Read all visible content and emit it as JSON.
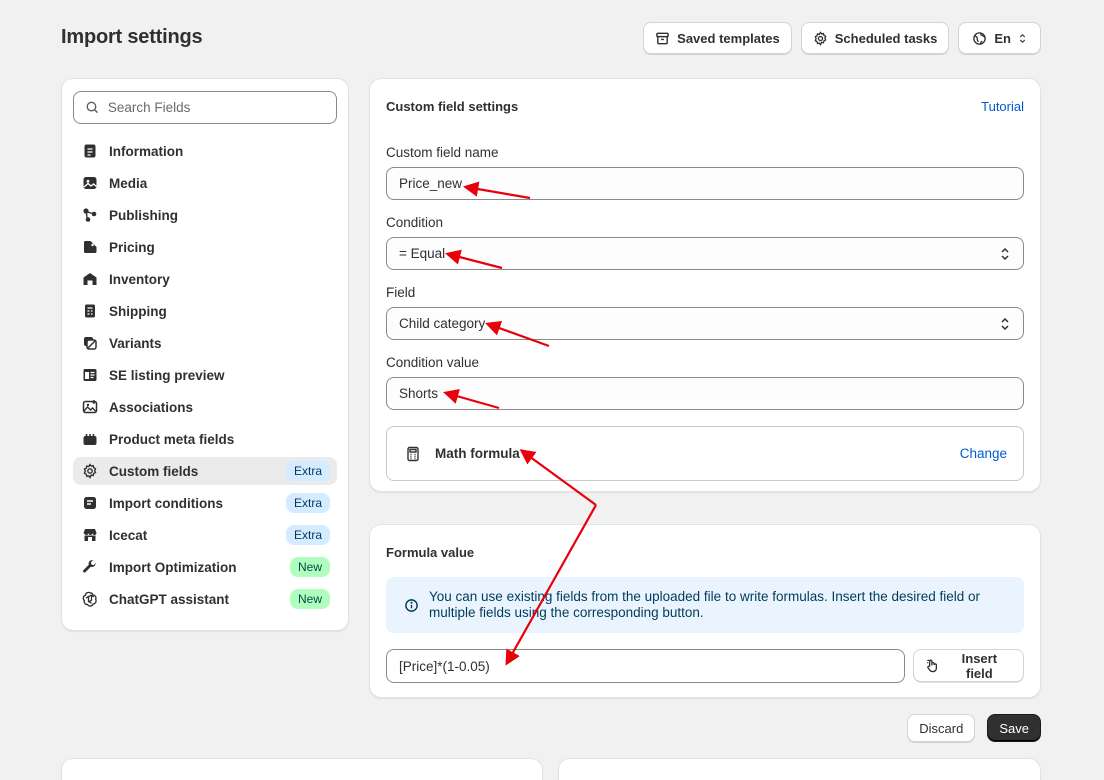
{
  "page": {
    "title": "Import settings"
  },
  "header": {
    "saved_templates": "Saved templates",
    "scheduled_tasks": "Scheduled tasks",
    "language": "En"
  },
  "sidebar": {
    "search_placeholder": "Search Fields",
    "items": [
      {
        "label": "Information",
        "icon": "information-icon",
        "badge": ""
      },
      {
        "label": "Media",
        "icon": "image-icon",
        "badge": ""
      },
      {
        "label": "Publishing",
        "icon": "publishing-icon",
        "badge": ""
      },
      {
        "label": "Pricing",
        "icon": "price-tag-icon",
        "badge": ""
      },
      {
        "label": "Inventory",
        "icon": "warehouse-icon",
        "badge": ""
      },
      {
        "label": "Shipping",
        "icon": "shipping-icon",
        "badge": ""
      },
      {
        "label": "Variants",
        "icon": "variants-icon",
        "badge": ""
      },
      {
        "label": "SE listing preview",
        "icon": "listing-preview-icon",
        "badge": ""
      },
      {
        "label": "Associations",
        "icon": "associations-icon",
        "badge": ""
      },
      {
        "label": "Product meta fields",
        "icon": "meta-fields-icon",
        "badge": ""
      },
      {
        "label": "Custom fields",
        "icon": "gear-icon",
        "badge": "Extra"
      },
      {
        "label": "Import conditions",
        "icon": "conditions-icon",
        "badge": "Extra"
      },
      {
        "label": "Icecat",
        "icon": "store-icon",
        "badge": "Extra"
      },
      {
        "label": "Import Optimization",
        "icon": "wrench-icon",
        "badge": "New"
      },
      {
        "label": "ChatGPT assistant",
        "icon": "chatgpt-icon",
        "badge": "New"
      }
    ]
  },
  "settings": {
    "title": "Custom field settings",
    "tutorial": "Tutorial",
    "name_label": "Custom field name",
    "name_value": "Price_new",
    "condition_label": "Condition",
    "condition_value": "= Equal",
    "field_label": "Field",
    "field_value": "Child category",
    "condition_value_label": "Condition value",
    "condition_value_value": "Shorts",
    "formula_type": "Math formula",
    "change": "Change"
  },
  "formula": {
    "title": "Formula value",
    "info": "You can use existing fields from the uploaded file to write formulas. Insert the desired field or multiple fields using the corresponding button.",
    "value": "[Price]*(1-0.05)",
    "insert_field": "Insert field"
  },
  "footer": {
    "discard": "Discard",
    "save": "Save"
  },
  "colors": {
    "accent": "#005bd3",
    "annotation": "#e8000b",
    "primary": "#303030"
  }
}
